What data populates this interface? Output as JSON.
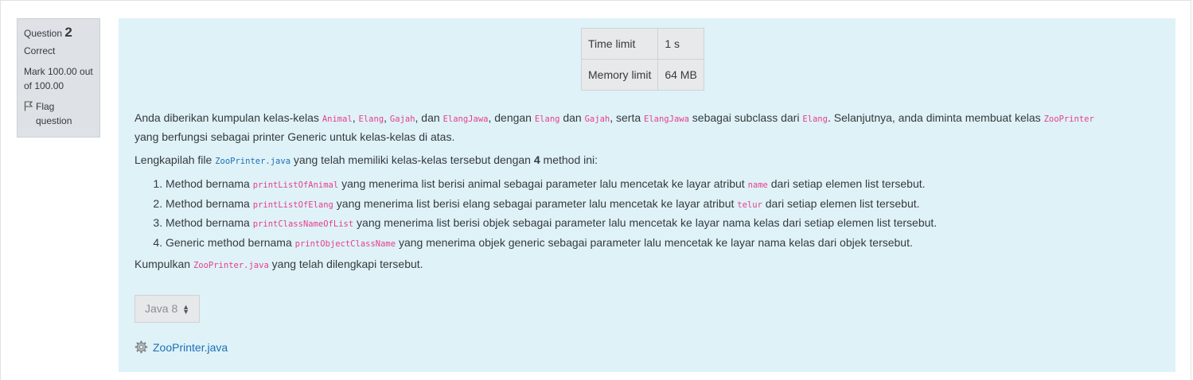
{
  "question_info": {
    "label": "Question",
    "number": "2",
    "state": "Correct",
    "grade": "Mark 100.00 out of 100.00",
    "flag_label": "Flag question"
  },
  "limits": {
    "time_label": "Time limit",
    "time_value": "1 s",
    "memory_label": "Memory limit",
    "memory_value": "64 MB"
  },
  "text": {
    "p1_a": "Anda diberikan kumpulan kelas-kelas ",
    "c_animal": "Animal",
    "sep1": ", ",
    "c_elang": "Elang",
    "sep2": ", ",
    "c_gajah": "Gajah",
    "p1_b": ", dan ",
    "c_elangjawa": "ElangJawa",
    "p1_c": ", dengan ",
    "c_elang2": "Elang",
    "p1_d": " dan ",
    "c_gajah2": "Gajah",
    "p1_e": ", serta ",
    "c_elangjawa2": "ElangJawa",
    "p1_f": " sebagai subclass dari ",
    "c_elang3": "Elang",
    "p1_g": ". Selanjutnya, anda diminta membuat kelas ",
    "c_zooprinter": "ZooPrinter",
    "p1_h": " yang berfungsi sebagai printer Generic untuk kelas-kelas di atas.",
    "p2_a": "Lengkapilah file ",
    "c_file": "ZooPrinter.java",
    "p2_b": " yang telah memiliki kelas-kelas tersebut dengan ",
    "p2_count": "4",
    "p2_c": " method ini:",
    "items": [
      {
        "pre": "Method bernama ",
        "code": "printListOfAnimal",
        "mid": " yang menerima list berisi animal sebagai parameter lalu mencetak ke layar atribut ",
        "code2": "name",
        "post": " dari setiap elemen list tersebut."
      },
      {
        "pre": "Method bernama ",
        "code": "printListOfElang",
        "mid": " yang menerima list berisi elang sebagai parameter lalu mencetak ke layar atribut ",
        "code2": "telur",
        "post": " dari setiap elemen list tersebut."
      },
      {
        "pre": "Method bernama ",
        "code": "printClassNameOfList",
        "mid": " yang menerima list berisi objek sebagai parameter lalu mencetak ke layar nama kelas dari setiap elemen list tersebut."
      },
      {
        "pre": "Generic method bernama ",
        "code": "printObjectClassName",
        "mid": " yang menerima objek generic sebagai parameter lalu mencetak ke layar nama kelas dari objek tersebut."
      }
    ],
    "p3_a": "Kumpulkan ",
    "c_file2": "ZooPrinter.java",
    "p3_b": " yang telah dilengkapi tersebut."
  },
  "language_select": {
    "value": "Java 8"
  },
  "attachment": {
    "filename": "ZooPrinter.java",
    "icon": "gear-icon"
  }
}
